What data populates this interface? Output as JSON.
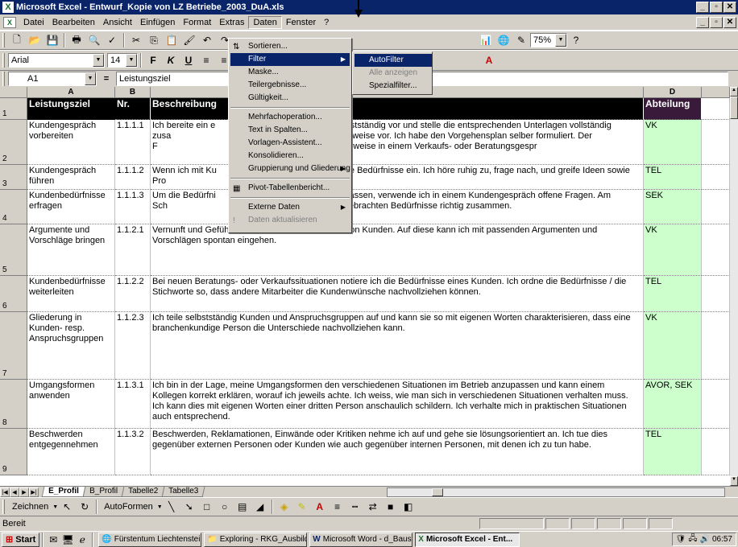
{
  "title_bar": {
    "title": "Microsoft Excel - Entwurf_Kopie von LZ Betriebe_2003_DuA.xls"
  },
  "menu": [
    "Datei",
    "Bearbeiten",
    "Ansicht",
    "Einfügen",
    "Format",
    "Extras",
    "Daten",
    "Fenster",
    "?"
  ],
  "toolbar": {
    "zoom": "75%",
    "font": "Arial",
    "size": "14"
  },
  "formula": {
    "cell_ref": "A1",
    "eq": "=",
    "content": "Leistungsziel"
  },
  "columns": [
    "A",
    "B",
    "C",
    "D"
  ],
  "header_row": {
    "a": "Leistungsziel",
    "b": "Nr.",
    "c": "Beschreibung",
    "d": "Abteilung",
    "num": "1"
  },
  "rows": [
    {
      "num": "2",
      "a": "Kundengespräch vorbereiten",
      "b": "1.1.1.1",
      "c": "Ich bereite ein e                                                  elbstständig vor und stelle die entsprechenden Unterlagen vollständig zusa                                             einem Plan schrittweise vor. Ich habe den Vorgehensplan selber formuliert. Der F                                          Elemente, die typischerweise in einem Verkaufs- oder Beratungsgespr",
      "d": "VK",
      "h": 56
    },
    {
      "num": "3",
      "a": "Kundengespräch führen",
      "b": "1.1.1.2",
      "c": "Wenn ich mit Ku                                                  ihre Bedürfnisse ein. Ich höre ruhig zu, frage nach, und greife Ideen sowie Pro",
      "d": "TEL",
      "h": 31
    },
    {
      "num": "4",
      "a": "Kundenbedürfnisse erfragen",
      "b": "1.1.1.3",
      "c": "Um die Bedürfni                                                  erfassen, verwende ich in einem Kundengespräch offene Fragen. Am Sch                                                        ch die vorgebrachten Bedürfnisse richtig zusammen.",
      "d": "SEK",
      "h": 43
    },
    {
      "num": "5",
      "a": "Argumente und Vorschläge bringen",
      "b": "1.1.2.1",
      "c": "Vernunft und Gefühle bestimmen die Kaufmotive von Kunden. Auf diese kann ich mit passenden Argumenten und Vorschlägen spontan eingehen.",
      "d": "VK",
      "h": 64
    },
    {
      "num": "6",
      "a": "Kundenbedürfnisse weiterleiten",
      "b": "1.1.2.2",
      "c": "Bei neuen Beratungs- oder Verkaufssituationen notiere ich die Bedürfnisse eines Kunden. Ich ordne die Bedürfnisse / die Stichworte so, dass andere Mitarbeiter die Kundenwünsche nachvollziehen können.",
      "d": "TEL",
      "h": 45
    },
    {
      "num": "7",
      "a": "Gliederung in Kunden- resp. Anspruchsgruppen",
      "b": "1.1.2.3",
      "c": "Ich teile selbstständig Kunden und Anspruchsgruppen auf und kann sie so mit eigenen Worten charakterisieren, dass eine branchenkundige Person die Unterschiede nachvollziehen kann.",
      "d": "VK",
      "h": 84
    },
    {
      "num": "8",
      "a": "Umgangsformen anwenden",
      "b": "1.1.3.1",
      "c": "Ich bin in der Lage, meine Umgangsformen den verschiedenen Situationen im Betrieb anzupassen und kann einem Kollegen korrekt erklären, worauf ich jeweils achte. Ich weiss, wie man sich in verschiedenen Situationen verhalten muss. Ich kann dies mit eigenen Worten einer dritten Person anschaulich schildern. Ich verhalte mich in praktischen Situationen auch entsprechend.",
      "d": "AVOR, SEK",
      "h": 61
    },
    {
      "num": "9",
      "a": "Beschwerden entgegennehmen",
      "b": "1.1.3.2",
      "c": "Beschwerden, Reklamationen, Einwände oder Kritiken nehme ich auf und gehe sie lösungsorientiert an. Ich tue dies gegenüber externen Personen  oder Kunden wie auch gegenüber internen Personen, mit denen ich zu tun habe.",
      "d": "TEL",
      "h": 58
    }
  ],
  "sheet_tabs": [
    "E_Profil",
    "B_Profil",
    "Tabelle2",
    "Tabelle3"
  ],
  "draw_toolbar": {
    "zeichnen": "Zeichnen",
    "autoformen": "AutoFormen"
  },
  "status": "Bereit",
  "data_menu": [
    {
      "label": "Sortieren...",
      "icon": "sort-icon"
    },
    {
      "label": "Filter",
      "submenu": true,
      "highlighted": true
    },
    {
      "label": "Maske..."
    },
    {
      "label": "Teilergebnisse..."
    },
    {
      "label": "Gültigkeit..."
    },
    {
      "label": "Mehrfachoperation..."
    },
    {
      "label": "Text in Spalten..."
    },
    {
      "label": "Vorlagen-Assistent..."
    },
    {
      "label": "Konsolidieren..."
    },
    {
      "label": "Gruppierung und Gliederung",
      "submenu": true
    },
    {
      "label": "Pivot-Tabellenbericht...",
      "icon": "pivot-icon"
    },
    {
      "label": "Externe Daten",
      "submenu": true
    },
    {
      "label": "Daten aktualisieren",
      "disabled": true
    }
  ],
  "filter_menu": [
    {
      "label": "AutoFilter",
      "highlighted": true
    },
    {
      "label": "Alle anzeigen",
      "disabled": true
    },
    {
      "label": "Spezialfilter..."
    }
  ],
  "taskbar": {
    "start": "Start",
    "tasks": [
      "Fürstentum Liechtenstein I...",
      "Exploring - RKG_Ausbildun...",
      "Microsoft Word - d_Bauste...",
      "Microsoft Excel - Ent..."
    ],
    "clock": "06:57"
  }
}
